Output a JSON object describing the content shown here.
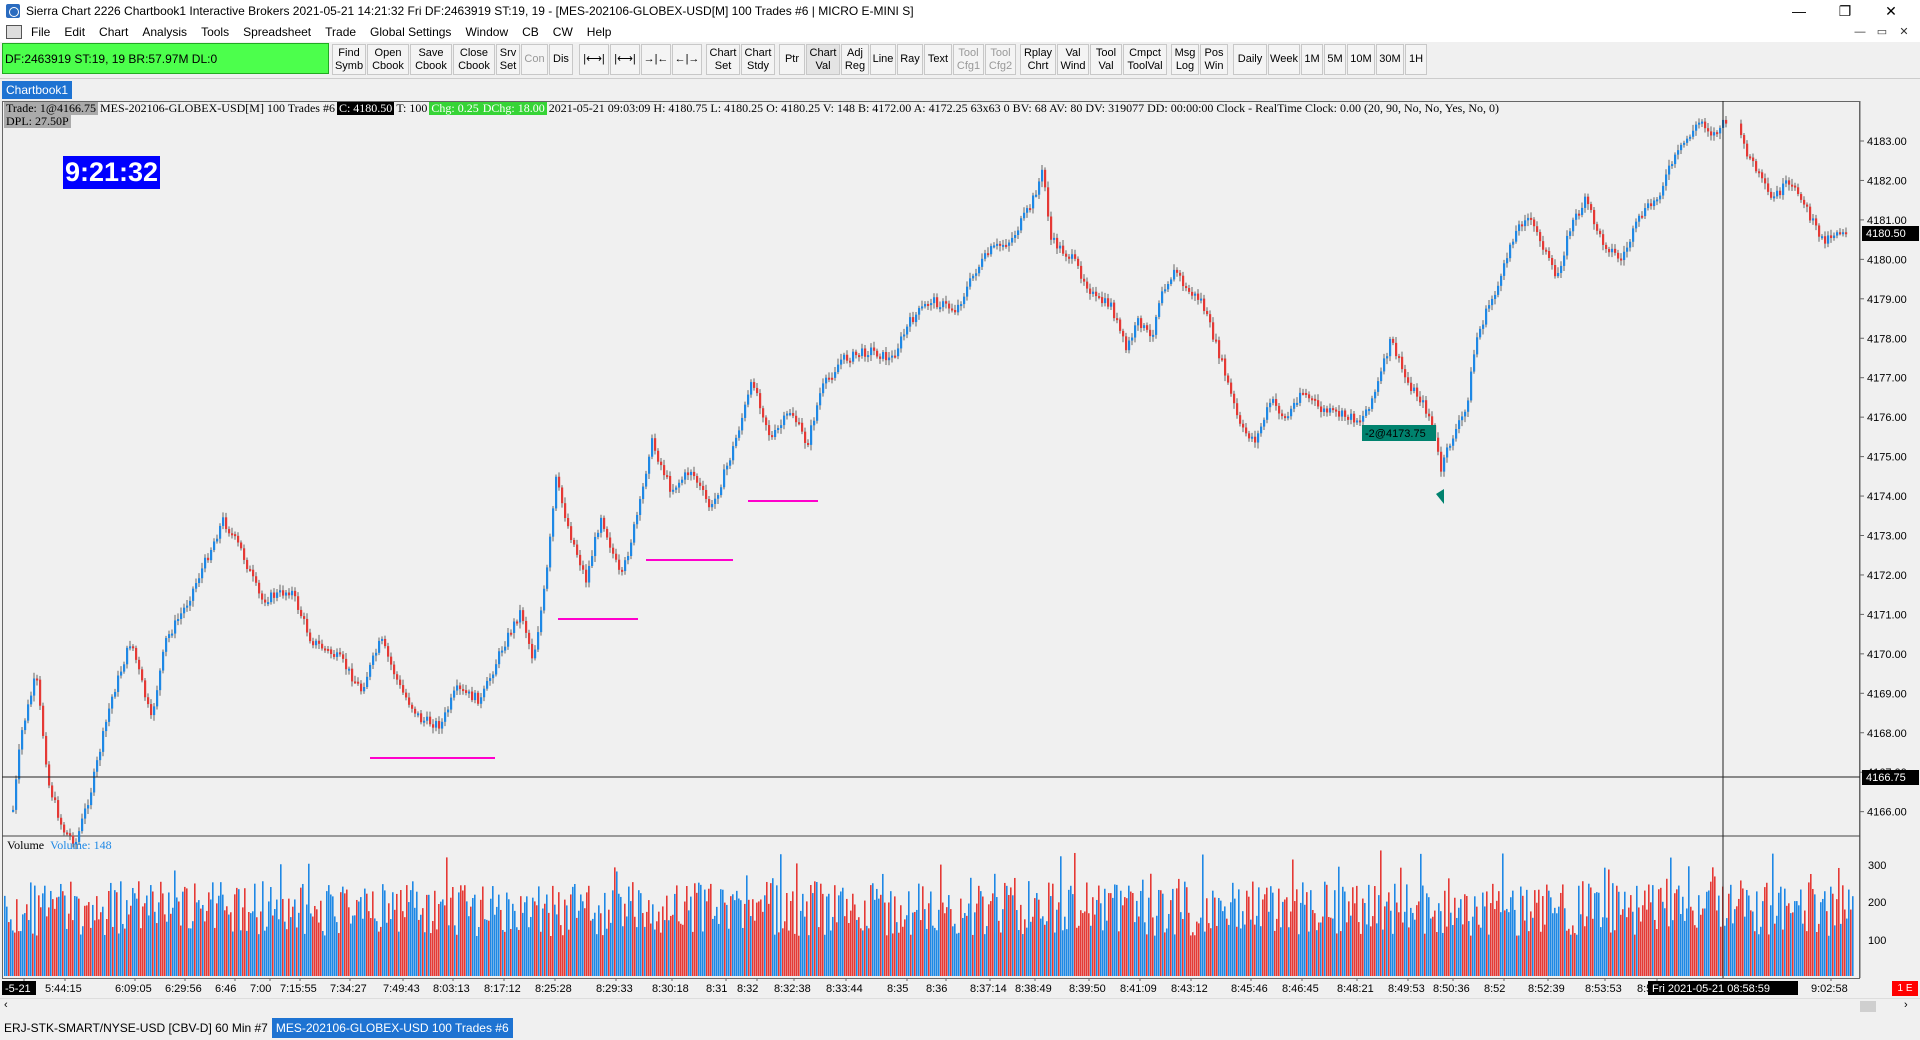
{
  "window": {
    "title": "Sierra Chart 2226 Chartbook1  Interactive Brokers 2021-05-21  14:21:32 Fri  DF:2463919  ST:19, 19 - [MES-202106-GLOBEX-USD[M]  100 Trades  #6 | MICRO E-MINI S]",
    "minimize": "—",
    "restore": "❐",
    "close": "✕"
  },
  "menu": {
    "items": [
      "File",
      "Edit",
      "Chart",
      "Analysis",
      "Tools",
      "Spreadsheet",
      "Trade",
      "Global Settings",
      "Window",
      "CB",
      "CW",
      "Help"
    ],
    "mdi_min": "—",
    "mdi_restore": "▭",
    "mdi_close": "✕"
  },
  "toolbar": {
    "status": "DF:2463919  ST:19, 19  BR:57.97M  DL:0",
    "buttons": [
      {
        "label": "Find\nSymb"
      },
      {
        "label": "Open\nCbook"
      },
      {
        "label": "Save\nCbook"
      },
      {
        "label": "Close\nCbook"
      },
      {
        "label": "Srv\nSet"
      },
      {
        "label": "Con"
      },
      {
        "label": "Dis"
      },
      {
        "label": "|⟷|"
      },
      {
        "label": "|⟷|"
      },
      {
        "label": "→|←"
      },
      {
        "label": "←|→"
      },
      {
        "label": "Chart\nSet"
      },
      {
        "label": "Chart\nStdy"
      },
      {
        "label": "Ptr"
      },
      {
        "label": "Chart\nVal"
      },
      {
        "label": "Adj\nReg"
      },
      {
        "label": "Line"
      },
      {
        "label": "Ray"
      },
      {
        "label": "Text"
      },
      {
        "label": "Tool\nCfg1"
      },
      {
        "label": "Tool\nCfg2"
      },
      {
        "label": "Rplay\nChrt"
      },
      {
        "label": "Val\nWind"
      },
      {
        "label": "Tool\nVal"
      },
      {
        "label": "Cmpct\nToolVal"
      },
      {
        "label": "Msg\nLog"
      },
      {
        "label": "Pos\nWin"
      },
      {
        "label": "Daily"
      },
      {
        "label": "Week"
      },
      {
        "label": "1M"
      },
      {
        "label": "5M"
      },
      {
        "label": "10M"
      },
      {
        "label": "30M"
      },
      {
        "label": "1H"
      }
    ]
  },
  "chartbook_tab": "Chartbook1",
  "info_bar": {
    "trade": "Trade: 1@4166.75",
    "symbol": "MES-202106-GLOBEX-USD[M]  100 Trades  #6",
    "close": "C: 4180.50",
    "t": "T: 100",
    "chg": "Chg: 0.25",
    "dchg": "DChg: 18.00",
    "rest": "2021-05-21 09:03:09 H: 4180.75 L: 4180.25 O: 4180.25 V: 148 B: 4172.00 A: 4172.25 63x63 0 BV: 68 AV: 80 DV: 319077 DD: 00:00:00 Clock - RealTime  Clock: 0.00   (20, 90, No, No, Yes, No, 0)",
    "dpl": "DPL: 27.50P"
  },
  "clock_display": "9:21:32",
  "order_label": "-2@4173.75",
  "price_axis": {
    "ticks": [
      "4183.00",
      "4182.00",
      "4181.00",
      "4180.00",
      "4179.00",
      "4178.00",
      "4177.00",
      "4176.00",
      "4175.00",
      "4174.00",
      "4173.00",
      "4172.00",
      "4171.00",
      "4170.00",
      "4169.00",
      "4168.00",
      "4167.00",
      "4166.00"
    ],
    "current_price": "4180.50",
    "crosshair_price": "4166.75"
  },
  "volume_pane": {
    "title": "Volume",
    "value": "Volume: 148",
    "ticks": [
      "300",
      "200",
      "100"
    ]
  },
  "time_axis": {
    "labels": [
      "-5-21",
      "5:44:15",
      "6:09:05",
      "6:29:56",
      "6:46",
      "7:00",
      "7:15:55",
      "7:34:27",
      "7:49:43",
      "8:03:13",
      "8:17:12",
      "8:25:28",
      "8:29:33",
      "8:30:18",
      "8:31",
      "8:32",
      "8:32:38",
      "8:33:44",
      "8:35",
      "8:36",
      "8:37:14",
      "8:38:49",
      "8:39:50",
      "8:41:09",
      "8:43:12",
      "8:45:46",
      "8:46:45",
      "8:48:21",
      "8:49:53",
      "8:50:36",
      "8:52",
      "8:52:39",
      "8:53:53",
      "8:56",
      "9:02:58"
    ],
    "cursor_label": "Fri 2021-05-21  08:58:59",
    "corner": "1 E"
  },
  "bottom_tabs": [
    {
      "label": "ERJ-STK-SMART/NYSE-USD [CBV-D]  60 Min  #7"
    },
    {
      "label": "MES-202106-GLOBEX-USD  100 Trades  #6"
    }
  ],
  "colors": {
    "up": "#1e88e5",
    "down": "#e53935",
    "support": "#ff00cc",
    "clock_bg": "#0000ff",
    "status_bg": "#4cff4c",
    "order_label": "#00826e"
  },
  "chart_data": {
    "type": "candlestick",
    "series": [
      {
        "name": "Volume",
        "values": [
          148
        ]
      }
    ]
  }
}
